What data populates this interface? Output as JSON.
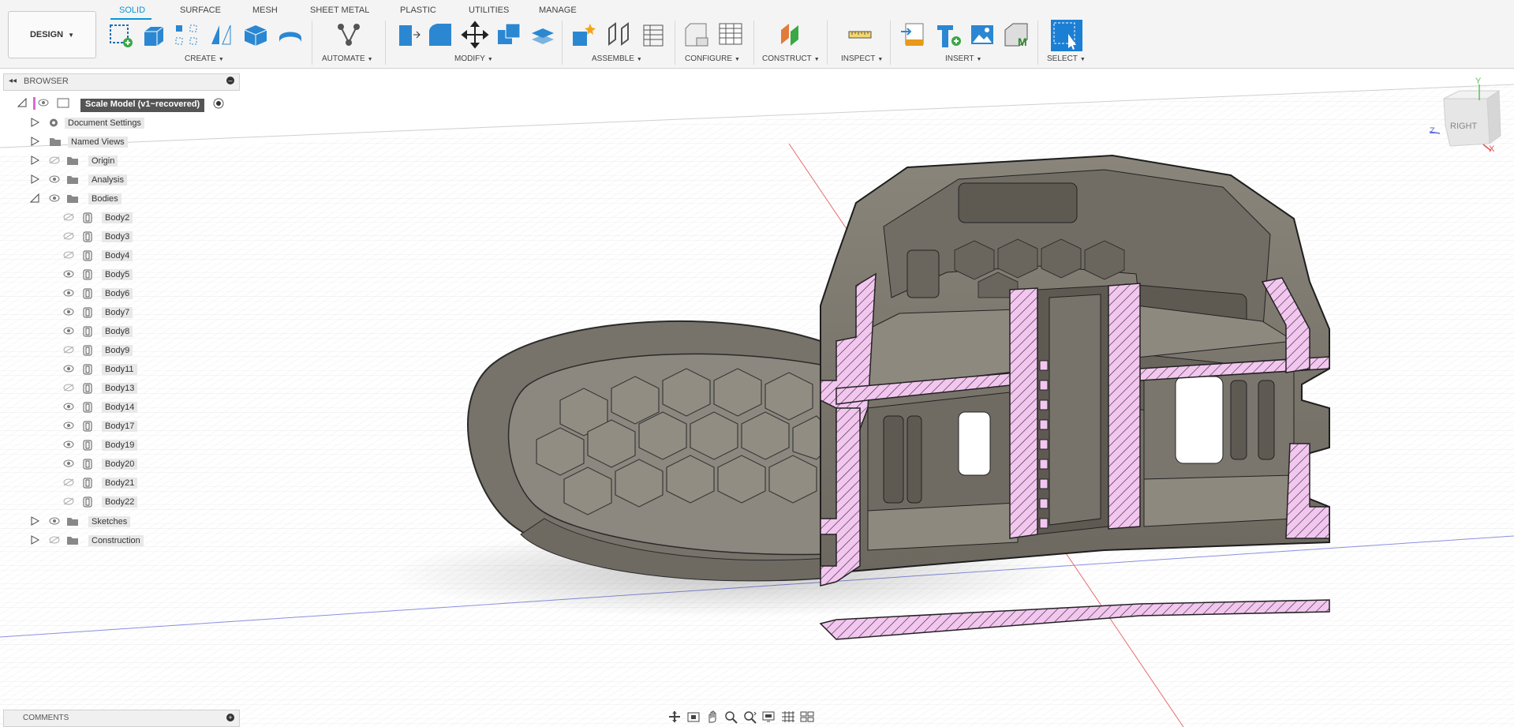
{
  "workspace": {
    "label": "DESIGN"
  },
  "tabs": [
    {
      "label": "SOLID",
      "active": true
    },
    {
      "label": "SURFACE",
      "active": false
    },
    {
      "label": "MESH",
      "active": false
    },
    {
      "label": "SHEET METAL",
      "active": false
    },
    {
      "label": "PLASTIC",
      "active": false
    },
    {
      "label": "UTILITIES",
      "active": false
    },
    {
      "label": "MANAGE",
      "active": false
    }
  ],
  "tool_groups": {
    "create": "CREATE",
    "automate": "AUTOMATE",
    "modify": "MODIFY",
    "assemble": "ASSEMBLE",
    "configure": "CONFIGURE",
    "construct": "CONSTRUCT",
    "inspect": "INSPECT",
    "insert": "INSERT",
    "select": "SELECT"
  },
  "browser": {
    "title": "BROWSER",
    "root": "Scale Model (v1~recovered)",
    "folders": {
      "document_settings": "Document Settings",
      "named_views": "Named Views",
      "origin": "Origin",
      "analysis": "Analysis",
      "bodies": "Bodies",
      "sketches": "Sketches",
      "construction": "Construction"
    },
    "bodies": [
      {
        "name": "Body2",
        "visible": false
      },
      {
        "name": "Body3",
        "visible": false
      },
      {
        "name": "Body4",
        "visible": false
      },
      {
        "name": "Body5",
        "visible": true
      },
      {
        "name": "Body6",
        "visible": true
      },
      {
        "name": "Body7",
        "visible": true
      },
      {
        "name": "Body8",
        "visible": true
      },
      {
        "name": "Body9",
        "visible": false
      },
      {
        "name": "Body11",
        "visible": true
      },
      {
        "name": "Body13",
        "visible": false
      },
      {
        "name": "Body14",
        "visible": true
      },
      {
        "name": "Body17",
        "visible": true
      },
      {
        "name": "Body19",
        "visible": true
      },
      {
        "name": "Body20",
        "visible": true
      },
      {
        "name": "Body21",
        "visible": false
      },
      {
        "name": "Body22",
        "visible": false
      }
    ]
  },
  "comments": {
    "title": "COMMENTS"
  },
  "viewcube": {
    "face": "RIGHT",
    "axis_y": "Y",
    "axis_z": "Z",
    "axis_x": "X"
  },
  "colors": {
    "accent": "#0696d7",
    "section_fill": "#f3c6f0",
    "model_gray": "#7d786e",
    "grid_line": "#dcdcdc"
  }
}
